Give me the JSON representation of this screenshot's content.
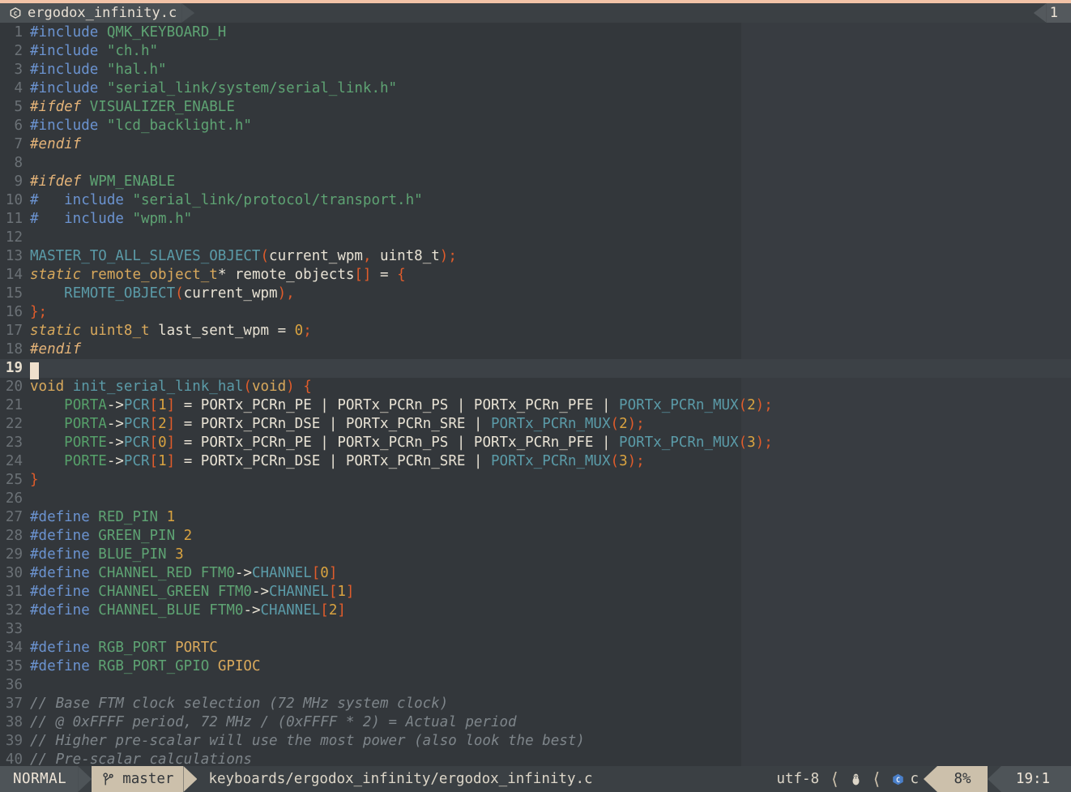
{
  "window": {
    "accent_color": "#f2c3a7",
    "bg": "#33373b"
  },
  "tabline": {
    "file_icon": "c-file-icon",
    "tab_title": "ergodox_infinity.c",
    "tab_count": "1"
  },
  "editor": {
    "colorcolumn_at": 80,
    "cursor_line": 19,
    "lines": [
      {
        "n": "1",
        "segs": [
          {
            "t": "#include ",
            "c": "pp"
          },
          {
            "t": "QMK_KEYBOARD_H",
            "c": "str"
          }
        ]
      },
      {
        "n": "2",
        "segs": [
          {
            "t": "#include ",
            "c": "pp"
          },
          {
            "t": "\"ch.h\"",
            "c": "str"
          }
        ]
      },
      {
        "n": "3",
        "segs": [
          {
            "t": "#include ",
            "c": "pp"
          },
          {
            "t": "\"hal.h\"",
            "c": "str"
          }
        ]
      },
      {
        "n": "4",
        "segs": [
          {
            "t": "#include ",
            "c": "pp"
          },
          {
            "t": "\"serial_link/system/serial_link.h\"",
            "c": "str"
          }
        ]
      },
      {
        "n": "5",
        "segs": [
          {
            "t": "#ifdef ",
            "c": "ppi"
          },
          {
            "t": "VISUALIZER_ENABLE",
            "c": "str"
          }
        ]
      },
      {
        "n": "6",
        "segs": [
          {
            "t": "#include ",
            "c": "pp"
          },
          {
            "t": "\"lcd_backlight.h\"",
            "c": "str"
          }
        ]
      },
      {
        "n": "7",
        "segs": [
          {
            "t": "#endif",
            "c": "ppi"
          }
        ]
      },
      {
        "n": "8",
        "segs": []
      },
      {
        "n": "9",
        "segs": [
          {
            "t": "#ifdef ",
            "c": "ppi"
          },
          {
            "t": "WPM_ENABLE",
            "c": "str"
          }
        ]
      },
      {
        "n": "10",
        "segs": [
          {
            "t": "#   include ",
            "c": "pp"
          },
          {
            "t": "\"serial_link/protocol/transport.h\"",
            "c": "str"
          }
        ]
      },
      {
        "n": "11",
        "segs": [
          {
            "t": "#   include ",
            "c": "pp"
          },
          {
            "t": "\"wpm.h\"",
            "c": "str"
          }
        ]
      },
      {
        "n": "12",
        "segs": []
      },
      {
        "n": "13",
        "segs": [
          {
            "t": "MASTER_TO_ALL_SLAVES_OBJECT",
            "c": "cy"
          },
          {
            "t": "(",
            "c": "punc"
          },
          {
            "t": "current_wpm",
            "c": "ident"
          },
          {
            "t": ",",
            "c": "punc"
          },
          {
            "t": " ",
            "c": "ident"
          },
          {
            "t": "uint8_t",
            "c": "ident"
          },
          {
            "t": ");",
            "c": "punc"
          }
        ]
      },
      {
        "n": "14",
        "segs": [
          {
            "t": "static",
            "c": "kw"
          },
          {
            "t": " ",
            "c": "ident"
          },
          {
            "t": "remote_object_t",
            "c": "type"
          },
          {
            "t": "* remote_objects",
            "c": "ident"
          },
          {
            "t": "[]",
            "c": "punc"
          },
          {
            "t": " = ",
            "c": "op"
          },
          {
            "t": "{",
            "c": "punc"
          }
        ]
      },
      {
        "n": "15",
        "segs": [
          {
            "t": "    ",
            "c": "ident"
          },
          {
            "t": "REMOTE_OBJECT",
            "c": "cy"
          },
          {
            "t": "(",
            "c": "punc"
          },
          {
            "t": "current_wpm",
            "c": "ident"
          },
          {
            "t": "),",
            "c": "punc"
          }
        ]
      },
      {
        "n": "16",
        "segs": [
          {
            "t": "};",
            "c": "punc"
          }
        ]
      },
      {
        "n": "17",
        "segs": [
          {
            "t": "static",
            "c": "kw"
          },
          {
            "t": " ",
            "c": "ident"
          },
          {
            "t": "uint8_t",
            "c": "type"
          },
          {
            "t": " last_sent_wpm ",
            "c": "ident"
          },
          {
            "t": "= ",
            "c": "op"
          },
          {
            "t": "0",
            "c": "num"
          },
          {
            "t": ";",
            "c": "punc"
          }
        ]
      },
      {
        "n": "18",
        "segs": [
          {
            "t": "#endif",
            "c": "ppi"
          }
        ]
      },
      {
        "n": "19",
        "segs": [],
        "cursor": true
      },
      {
        "n": "20",
        "segs": [
          {
            "t": "void",
            "c": "kwn"
          },
          {
            "t": " ",
            "c": "ident"
          },
          {
            "t": "init_serial_link_hal",
            "c": "fn"
          },
          {
            "t": "(",
            "c": "punc"
          },
          {
            "t": "void",
            "c": "kwn"
          },
          {
            "t": ")",
            "c": "punc"
          },
          {
            "t": " ",
            "c": "ident"
          },
          {
            "t": "{",
            "c": "punc"
          }
        ]
      },
      {
        "n": "21",
        "segs": [
          {
            "t": "    ",
            "c": "ident"
          },
          {
            "t": "PORTA",
            "c": "gr"
          },
          {
            "t": "->",
            "c": "op"
          },
          {
            "t": "PCR",
            "c": "cy"
          },
          {
            "t": "[",
            "c": "punc"
          },
          {
            "t": "1",
            "c": "num"
          },
          {
            "t": "]",
            "c": "punc"
          },
          {
            "t": " = PORTx_PCRn_PE | PORTx_PCRn_PS | PORTx_PCRn_PFE | ",
            "c": "ident"
          },
          {
            "t": "PORTx_PCRn_MUX",
            "c": "cy"
          },
          {
            "t": "(",
            "c": "punc"
          },
          {
            "t": "2",
            "c": "num"
          },
          {
            "t": ");",
            "c": "punc"
          }
        ]
      },
      {
        "n": "22",
        "segs": [
          {
            "t": "    ",
            "c": "ident"
          },
          {
            "t": "PORTA",
            "c": "gr"
          },
          {
            "t": "->",
            "c": "op"
          },
          {
            "t": "PCR",
            "c": "cy"
          },
          {
            "t": "[",
            "c": "punc"
          },
          {
            "t": "2",
            "c": "num"
          },
          {
            "t": "]",
            "c": "punc"
          },
          {
            "t": " = PORTx_PCRn_DSE | PORTx_PCRn_SRE | ",
            "c": "ident"
          },
          {
            "t": "PORTx_PCRn_MUX",
            "c": "cy"
          },
          {
            "t": "(",
            "c": "punc"
          },
          {
            "t": "2",
            "c": "num"
          },
          {
            "t": ");",
            "c": "punc"
          }
        ]
      },
      {
        "n": "23",
        "segs": [
          {
            "t": "    ",
            "c": "ident"
          },
          {
            "t": "PORTE",
            "c": "gr"
          },
          {
            "t": "->",
            "c": "op"
          },
          {
            "t": "PCR",
            "c": "cy"
          },
          {
            "t": "[",
            "c": "punc"
          },
          {
            "t": "0",
            "c": "num"
          },
          {
            "t": "]",
            "c": "punc"
          },
          {
            "t": " = PORTx_PCRn_PE | PORTx_PCRn_PS | PORTx_PCRn_PFE | ",
            "c": "ident"
          },
          {
            "t": "PORTx_PCRn_MUX",
            "c": "cy"
          },
          {
            "t": "(",
            "c": "punc"
          },
          {
            "t": "3",
            "c": "num"
          },
          {
            "t": ");",
            "c": "punc"
          }
        ]
      },
      {
        "n": "24",
        "segs": [
          {
            "t": "    ",
            "c": "ident"
          },
          {
            "t": "PORTE",
            "c": "gr"
          },
          {
            "t": "->",
            "c": "op"
          },
          {
            "t": "PCR",
            "c": "cy"
          },
          {
            "t": "[",
            "c": "punc"
          },
          {
            "t": "1",
            "c": "num"
          },
          {
            "t": "]",
            "c": "punc"
          },
          {
            "t": " = PORTx_PCRn_DSE | PORTx_PCRn_SRE | ",
            "c": "ident"
          },
          {
            "t": "PORTx_PCRn_MUX",
            "c": "cy"
          },
          {
            "t": "(",
            "c": "punc"
          },
          {
            "t": "3",
            "c": "num"
          },
          {
            "t": ");",
            "c": "punc"
          }
        ]
      },
      {
        "n": "25",
        "segs": [
          {
            "t": "}",
            "c": "punc"
          }
        ]
      },
      {
        "n": "26",
        "segs": []
      },
      {
        "n": "27",
        "segs": [
          {
            "t": "#define ",
            "c": "pp"
          },
          {
            "t": "RED_PIN",
            "c": "str"
          },
          {
            "t": " ",
            "c": "ident"
          },
          {
            "t": "1",
            "c": "num"
          }
        ]
      },
      {
        "n": "28",
        "segs": [
          {
            "t": "#define ",
            "c": "pp"
          },
          {
            "t": "GREEN_PIN",
            "c": "str"
          },
          {
            "t": " ",
            "c": "ident"
          },
          {
            "t": "2",
            "c": "num"
          }
        ]
      },
      {
        "n": "29",
        "segs": [
          {
            "t": "#define ",
            "c": "pp"
          },
          {
            "t": "BLUE_PIN",
            "c": "str"
          },
          {
            "t": " ",
            "c": "ident"
          },
          {
            "t": "3",
            "c": "num"
          }
        ]
      },
      {
        "n": "30",
        "segs": [
          {
            "t": "#define ",
            "c": "pp"
          },
          {
            "t": "CHANNEL_RED",
            "c": "str"
          },
          {
            "t": " ",
            "c": "ident"
          },
          {
            "t": "FTM0",
            "c": "str"
          },
          {
            "t": "->",
            "c": "op"
          },
          {
            "t": "CHANNEL",
            "c": "cy"
          },
          {
            "t": "[",
            "c": "punc"
          },
          {
            "t": "0",
            "c": "num"
          },
          {
            "t": "]",
            "c": "punc"
          }
        ]
      },
      {
        "n": "31",
        "segs": [
          {
            "t": "#define ",
            "c": "pp"
          },
          {
            "t": "CHANNEL_GREEN",
            "c": "str"
          },
          {
            "t": " ",
            "c": "ident"
          },
          {
            "t": "FTM0",
            "c": "str"
          },
          {
            "t": "->",
            "c": "op"
          },
          {
            "t": "CHANNEL",
            "c": "cy"
          },
          {
            "t": "[",
            "c": "punc"
          },
          {
            "t": "1",
            "c": "num"
          },
          {
            "t": "]",
            "c": "punc"
          }
        ]
      },
      {
        "n": "32",
        "segs": [
          {
            "t": "#define ",
            "c": "pp"
          },
          {
            "t": "CHANNEL_BLUE",
            "c": "str"
          },
          {
            "t": " ",
            "c": "ident"
          },
          {
            "t": "FTM0",
            "c": "str"
          },
          {
            "t": "->",
            "c": "op"
          },
          {
            "t": "CHANNEL",
            "c": "cy"
          },
          {
            "t": "[",
            "c": "punc"
          },
          {
            "t": "2",
            "c": "num"
          },
          {
            "t": "]",
            "c": "punc"
          }
        ]
      },
      {
        "n": "33",
        "segs": []
      },
      {
        "n": "34",
        "segs": [
          {
            "t": "#define ",
            "c": "pp"
          },
          {
            "t": "RGB_PORT",
            "c": "str"
          },
          {
            "t": " ",
            "c": "ident"
          },
          {
            "t": "PORTC",
            "c": "type"
          }
        ]
      },
      {
        "n": "35",
        "segs": [
          {
            "t": "#define ",
            "c": "pp"
          },
          {
            "t": "RGB_PORT_GPIO",
            "c": "str"
          },
          {
            "t": " ",
            "c": "ident"
          },
          {
            "t": "GPIOC",
            "c": "type"
          }
        ]
      },
      {
        "n": "36",
        "segs": []
      },
      {
        "n": "37",
        "segs": [
          {
            "t": "// Base FTM clock selection (72 MHz system clock)",
            "c": "com"
          }
        ]
      },
      {
        "n": "38",
        "segs": [
          {
            "t": "// @ 0xFFFF period, 72 MHz / (0xFFFF * 2) = Actual period",
            "c": "com"
          }
        ]
      },
      {
        "n": "39",
        "segs": [
          {
            "t": "// Higher pre-scalar will use the most power (also look the best)",
            "c": "com"
          }
        ]
      },
      {
        "n": "40",
        "segs": [
          {
            "t": "// Pre-scalar calculations",
            "c": "com"
          }
        ]
      }
    ]
  },
  "statusline": {
    "mode": "NORMAL",
    "branch_icon": "git-branch-icon",
    "branch": "master",
    "file_path": "keyboards/ergodox_infinity/ergodox_infinity.c",
    "encoding": "utf-8",
    "os_icon": "linux-penguin-icon",
    "filetype_icon": "c-file-icon",
    "filetype": "c",
    "scroll_percent": "8%",
    "cursor_position": "19:1",
    "colors": {
      "mode_bg": "#4e5458",
      "branch_bg": "#ccc0ab",
      "statusline_bg": "#3b4044"
    }
  }
}
